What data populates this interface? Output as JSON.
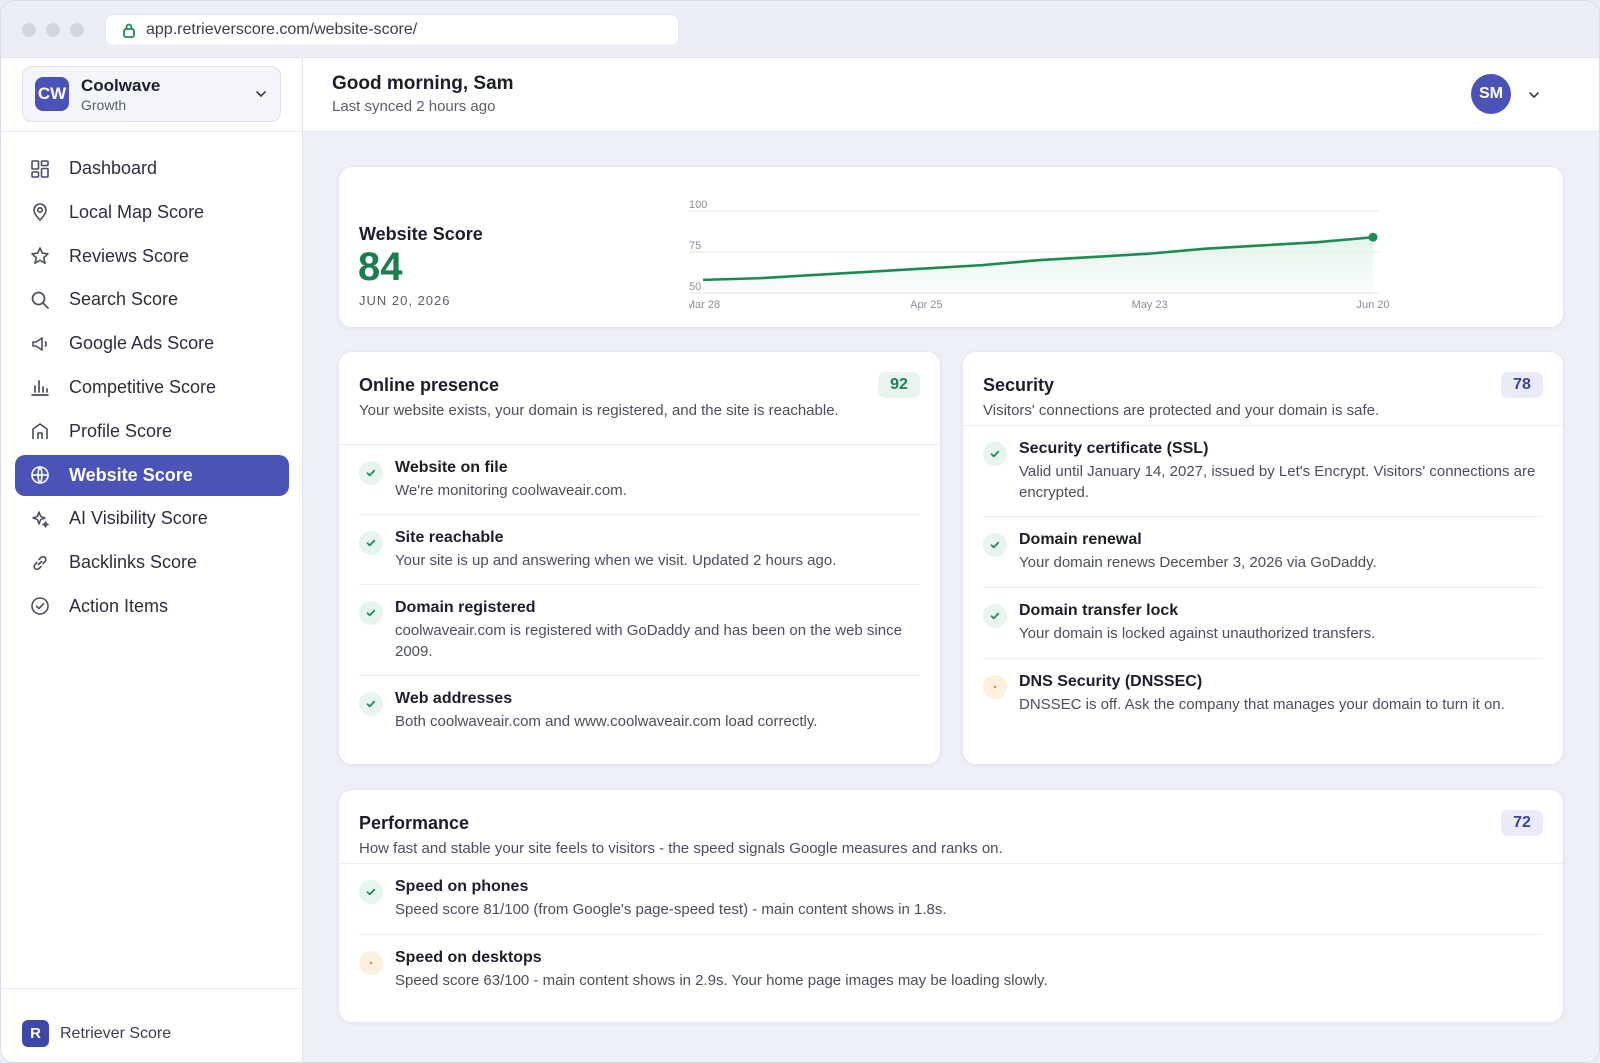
{
  "browser": {
    "url": "app.retrieverscore.com/website-score/"
  },
  "org": {
    "initials": "CW",
    "name": "Coolwave",
    "plan": "Growth"
  },
  "nav": [
    {
      "label": "Dashboard",
      "icon": "dashboard-icon"
    },
    {
      "label": "Local Map Score",
      "icon": "map-pin-icon"
    },
    {
      "label": "Reviews Score",
      "icon": "star-icon"
    },
    {
      "label": "Search Score",
      "icon": "search-icon"
    },
    {
      "label": "Google Ads Score",
      "icon": "megaphone-icon"
    },
    {
      "label": "Competitive Score",
      "icon": "bar-chart-icon"
    },
    {
      "label": "Profile Score",
      "icon": "storefront-icon"
    },
    {
      "label": "Website Score",
      "icon": "globe-icon",
      "active": true
    },
    {
      "label": "AI Visibility Score",
      "icon": "sparkle-icon"
    },
    {
      "label": "Backlinks Score",
      "icon": "link-icon"
    },
    {
      "label": "Action Items",
      "icon": "check-circle-icon"
    }
  ],
  "brand": {
    "logo_letter": "R",
    "name": "Retriever Score"
  },
  "header": {
    "greeting": "Good morning, Sam",
    "synced": "Last synced 2 hours ago",
    "user_initials": "SM"
  },
  "score_card": {
    "title": "Website Score",
    "value": "84",
    "date": "JUN 20, 2026"
  },
  "chart_data": {
    "type": "area",
    "x": [
      "Mar 28",
      "Apr 4",
      "Apr 11",
      "Apr 18",
      "Apr 25",
      "May 2",
      "May 9",
      "May 16",
      "May 23",
      "May 30",
      "Jun 6",
      "Jun 13",
      "Jun 20"
    ],
    "y": [
      58,
      59,
      61,
      63,
      65,
      67,
      70,
      72,
      74,
      77,
      79,
      81,
      84
    ],
    "xticks": [
      "Mar 28",
      "Apr 25",
      "May 23",
      "Jun 20"
    ],
    "yticks": [
      50,
      75,
      100
    ],
    "ylim": [
      50,
      100
    ],
    "grid": true,
    "colors": {
      "line": "#1e8a53",
      "fill": "#e3f4ea"
    }
  },
  "online_presence": {
    "title": "Online presence",
    "description": "Your website exists, your domain is registered, and the site is reachable.",
    "score": "92",
    "items": [
      {
        "title": "Website on file",
        "text": "We're monitoring coolwaveair.com.",
        "status": "ok"
      },
      {
        "title": "Site reachable",
        "text": "Your site is up and answering when we visit. Updated 2 hours ago.",
        "status": "ok"
      },
      {
        "title": "Domain registered",
        "text": "coolwaveair.com is registered with GoDaddy and has been on the web since 2009.",
        "status": "ok"
      },
      {
        "title": "Web addresses",
        "text": "Both coolwaveair.com and www.coolwaveair.com load correctly.",
        "status": "ok"
      }
    ]
  },
  "security": {
    "title": "Security",
    "description": "Visitors' connections are protected and your domain is safe.",
    "score": "78",
    "items": [
      {
        "title": "Security certificate (SSL)",
        "text": "Valid until January 14, 2027, issued by Let's Encrypt. Visitors' connections are encrypted.",
        "status": "ok"
      },
      {
        "title": "Domain renewal",
        "text": "Your domain renews December 3, 2026 via GoDaddy.",
        "status": "ok"
      },
      {
        "title": "Domain transfer lock",
        "text": "Your domain is locked against unauthorized transfers.",
        "status": "ok"
      },
      {
        "title": "DNS Security (DNSSEC)",
        "text": "DNSSEC is off. Ask the company that manages your domain to turn it on.",
        "status": "warn"
      }
    ]
  },
  "performance": {
    "title": "Performance",
    "description": "How fast and stable your site feels to visitors - the speed signals Google measures and ranks on.",
    "score": "72",
    "items": [
      {
        "title": "Speed on phones",
        "text": "Speed score 81/100 (from Google's page-speed test) - main content shows in 1.8s.",
        "status": "ok"
      },
      {
        "title": "Speed on desktops",
        "text": "Speed score 63/100 - main content shows in 2.9s. Your home page images may be loading slowly.",
        "status": "warn"
      }
    ]
  },
  "colors": {
    "accent": "#4b53b8",
    "success": "#1e7d4c",
    "warning": "#f3c88a"
  }
}
